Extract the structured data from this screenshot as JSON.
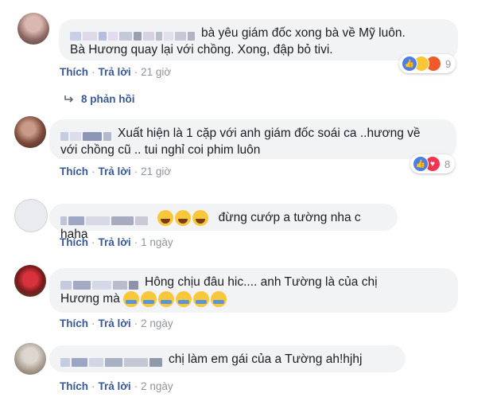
{
  "comments": [
    {
      "text_line1": "bà yêu giám đốc xong bà về Mỹ luôn.",
      "text_line2": "Bà Hương quay lại với chồng. Xong, đập bỏ tivi.",
      "like": "Thích",
      "reply": "Trả lời",
      "time": "21 giờ",
      "reaction_icons": [
        "like-icon",
        "haha-icon",
        "angry-icon"
      ],
      "reaction_count": "9",
      "replies_label": "8 phản hồi"
    },
    {
      "text_line1": "Xuất hiện là 1 cặp với anh giám đốc soái ca ..hương về",
      "text_line2": "với chồng cũ .. tui nghỉ coi phim luôn",
      "like": "Thích",
      "reply": "Trả lời",
      "time": "21 giờ",
      "reaction_icons": [
        "like-icon",
        "love-icon"
      ],
      "reaction_count": "8"
    },
    {
      "text_line1": "đừng cướp a tường nha c haha",
      "like": "Thích",
      "reply": "Trả lời",
      "time": "1 ngày"
    },
    {
      "text_line1": "Hông chịu đâu hic.... anh Tường là của chị",
      "text_line2": "Hương mà",
      "like": "Thích",
      "reply": "Trả lời",
      "time": "2 ngày"
    },
    {
      "text_line1": "chị làm em gái của a Tường ah!hjhj",
      "like": "Thích",
      "reply": "Trả lời",
      "time": "2 ngày"
    }
  ],
  "colors": {
    "link": "#385898",
    "muted": "#90949c",
    "bubble": "#f2f3f5"
  }
}
